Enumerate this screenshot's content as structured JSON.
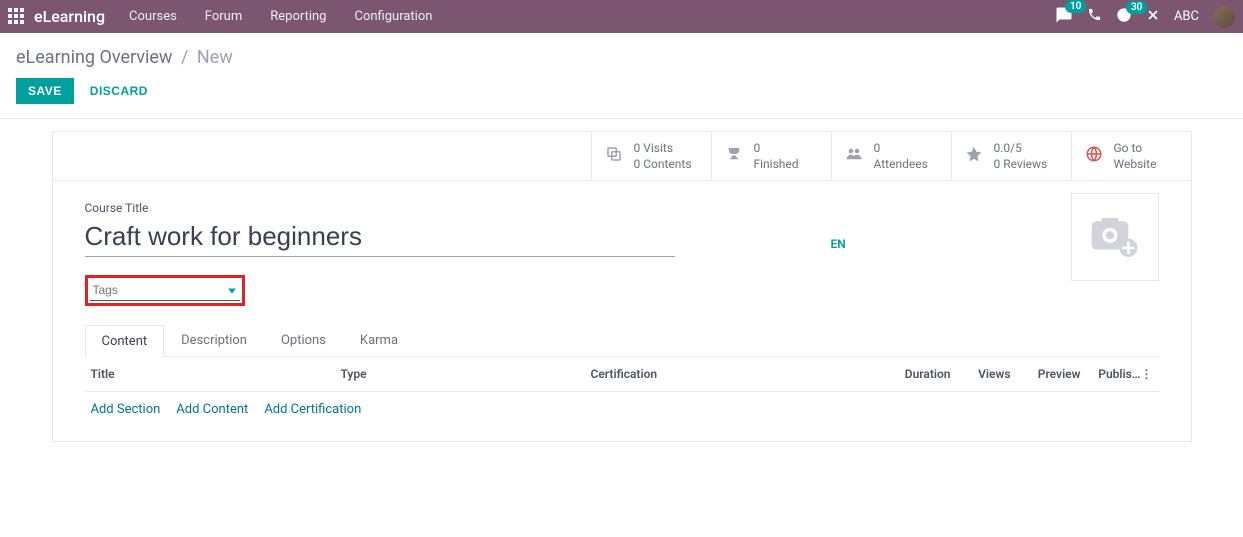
{
  "nav": {
    "brand": "eLearning",
    "items": [
      "Courses",
      "Forum",
      "Reporting",
      "Configuration"
    ],
    "msg_badge": "10",
    "activity_badge": "30",
    "user": "ABC"
  },
  "breadcrumb": {
    "link": "eLearning Overview",
    "current": "New"
  },
  "actions": {
    "save": "SAVE",
    "discard": "DISCARD"
  },
  "stats": {
    "visits": {
      "line1": "0 Visits",
      "line2": "0 Contents"
    },
    "finished": {
      "line1": "0",
      "line2": "Finished"
    },
    "attendees": {
      "line1": "0",
      "line2": "Attendees"
    },
    "rating": {
      "line1": "0.0/5",
      "line2": "0 Reviews"
    },
    "website": {
      "line1": "Go to",
      "line2": "Website"
    }
  },
  "form": {
    "title_label": "Course Title",
    "title_value": "Craft work for beginners",
    "lang": "EN",
    "tags_placeholder": "Tags"
  },
  "tabs": {
    "items": [
      "Content",
      "Description",
      "Options",
      "Karma"
    ]
  },
  "table": {
    "headers": {
      "title": "Title",
      "type": "Type",
      "cert": "Certification",
      "duration": "Duration",
      "views": "Views",
      "preview": "Preview",
      "publish": "Publis…"
    },
    "links": {
      "section": "Add Section",
      "content": "Add Content",
      "cert": "Add Certification"
    }
  }
}
